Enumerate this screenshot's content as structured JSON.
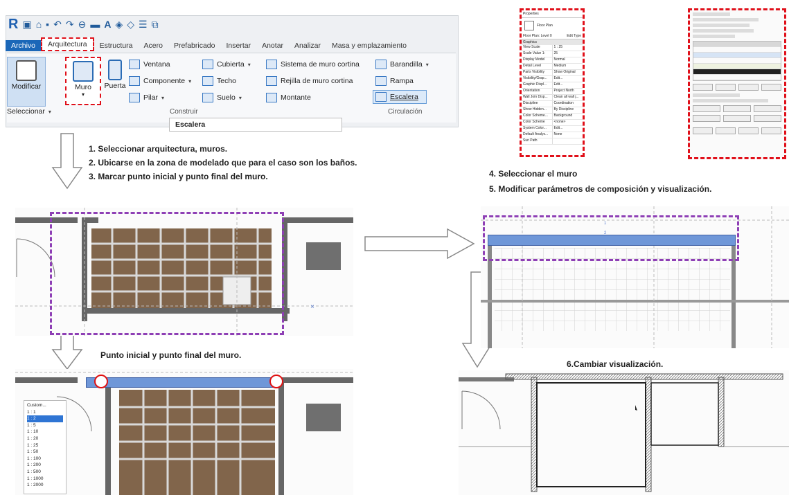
{
  "ribbon": {
    "tabs": [
      "Archivo",
      "Arquitectura",
      "Estructura",
      "Acero",
      "Prefabricado",
      "Insertar",
      "Anotar",
      "Analizar",
      "Masa y emplazamiento"
    ],
    "modificar_label": "Modificar",
    "muro_label": "Muro",
    "puerta_label": "Puerta",
    "col1": [
      "Ventana",
      "Componente",
      "Pilar"
    ],
    "col2": [
      "Cubierta",
      "Techo",
      "Suelo"
    ],
    "col3": [
      "Sistema de muro cortina",
      "Rejilla de muro cortina",
      "Montante"
    ],
    "col4": [
      "Barandilla",
      "Rampa",
      "Escalera"
    ],
    "seleccionar_label": "Seleccionar",
    "construir_label": "Construir",
    "circulacion_label": "Circulación",
    "tooltip": "Escalera"
  },
  "properties_panel": {
    "title": "Properties",
    "type": "Floor Plan",
    "selector": "Floor Plan: Level 0",
    "edit_type": "Edit Type",
    "section": "Graphics",
    "rows": [
      [
        "View Scale",
        "1 : 25"
      ],
      [
        "Scale Value 1:",
        "25"
      ],
      [
        "Display Model",
        "Normal"
      ],
      [
        "Detail Level",
        "Medium"
      ],
      [
        "Parts Visibility",
        "Show Original"
      ],
      [
        "Visibility/Grap...",
        "Edit..."
      ],
      [
        "Graphic Displ...",
        "Edit..."
      ],
      [
        "Orientation",
        "Project North"
      ],
      [
        "Wall Join Disp...",
        "Clean all wall j..."
      ],
      [
        "Discipline",
        "Coordination"
      ],
      [
        "Show Hidden...",
        "By Discipline"
      ],
      [
        "Color Scheme...",
        "Background"
      ],
      [
        "Color Scheme",
        "<none>"
      ],
      [
        "System Color...",
        "Edit..."
      ],
      [
        "Default Analys...",
        "None"
      ],
      [
        "Sun Path",
        ""
      ]
    ]
  },
  "steps_left": [
    "1.  Seleccionar arquitectura, muros.",
    "2.  Ubicarse en la zona de modelado que para el caso son los baños.",
    "3.  Marcar punto inicial y punto final del muro."
  ],
  "steps_right": [
    "4. Seleccionar el muro",
    "5. Modificar parámetros de composición y visualización."
  ],
  "caption_left": "Punto inicial y punto final del muro.",
  "caption_right": "6.Cambiar visualización.",
  "scale_list": [
    "Custom...",
    "1 : 1",
    "1 : 2",
    "1 : 5",
    "1 : 10",
    "1 : 20",
    "1 : 25",
    "1 : 50",
    "1 : 100",
    "1 : 200",
    "1 : 500",
    "1 : 1000",
    "1 : 2000"
  ],
  "colors": {
    "accent_red": "#e0101a",
    "selection_purple": "#8e3fb5",
    "wall_blue": "#6f97d8",
    "revit_blue": "#1b67b8"
  }
}
